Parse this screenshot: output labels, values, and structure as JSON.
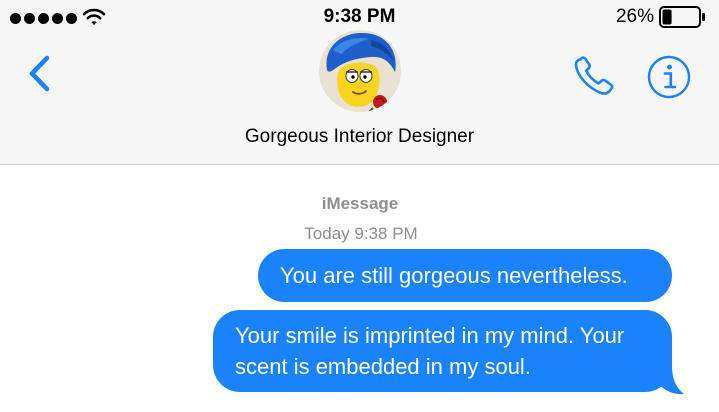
{
  "status_bar": {
    "time": "9:38 PM",
    "battery_percent": "26%",
    "battery_level": 0.26,
    "signal_bars": 5
  },
  "header": {
    "contact_name": "Gorgeous Interior Designer",
    "back_icon": "chevron-left-icon",
    "call_icon": "phone-icon",
    "info_icon": "info-icon"
  },
  "conversation": {
    "service_label": "iMessage",
    "timestamp": "Today 9:38 PM",
    "messages": [
      {
        "direction": "outgoing",
        "text": "You are still gorgeous nevertheless."
      },
      {
        "direction": "outgoing",
        "text_line1": "Your smile is imprinted in my mind. Your",
        "text_line2": "scent is embedded in my soul."
      }
    ]
  },
  "colors": {
    "accent": "#1a82fb",
    "header_bg": "#f7f7f7",
    "meta_text": "#8e8e93"
  }
}
